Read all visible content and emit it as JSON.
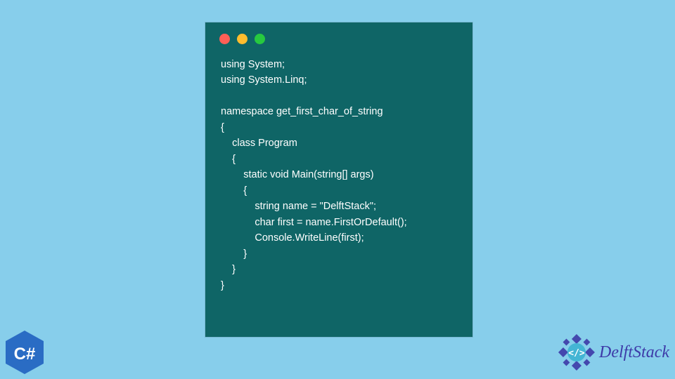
{
  "window": {
    "controls": {
      "red": "#ff5f56",
      "yellow": "#ffbd2e",
      "green": "#27c93f"
    }
  },
  "code": {
    "line1": "using System;",
    "line2": "using System.Linq;",
    "line3": "",
    "line4": "namespace get_first_char_of_string",
    "line5": "{",
    "line6": "    class Program",
    "line7": "    {",
    "line8": "        static void Main(string[] args)",
    "line9": "        {",
    "line10": "            string name = \"DelftStack\";",
    "line11": "            char first = name.FirstOrDefault();",
    "line12": "            Console.WriteLine(first);",
    "line13": "        }",
    "line14": "    }",
    "line15": "}"
  },
  "badges": {
    "csharp": "C#",
    "brand": "DelftStack"
  },
  "colors": {
    "background": "#87ceeb",
    "codeWindow": "#0f6566",
    "codeText": "#ffffff",
    "badgeBlue": "#2a6cc4",
    "brandPurple": "#3d3aa8"
  }
}
